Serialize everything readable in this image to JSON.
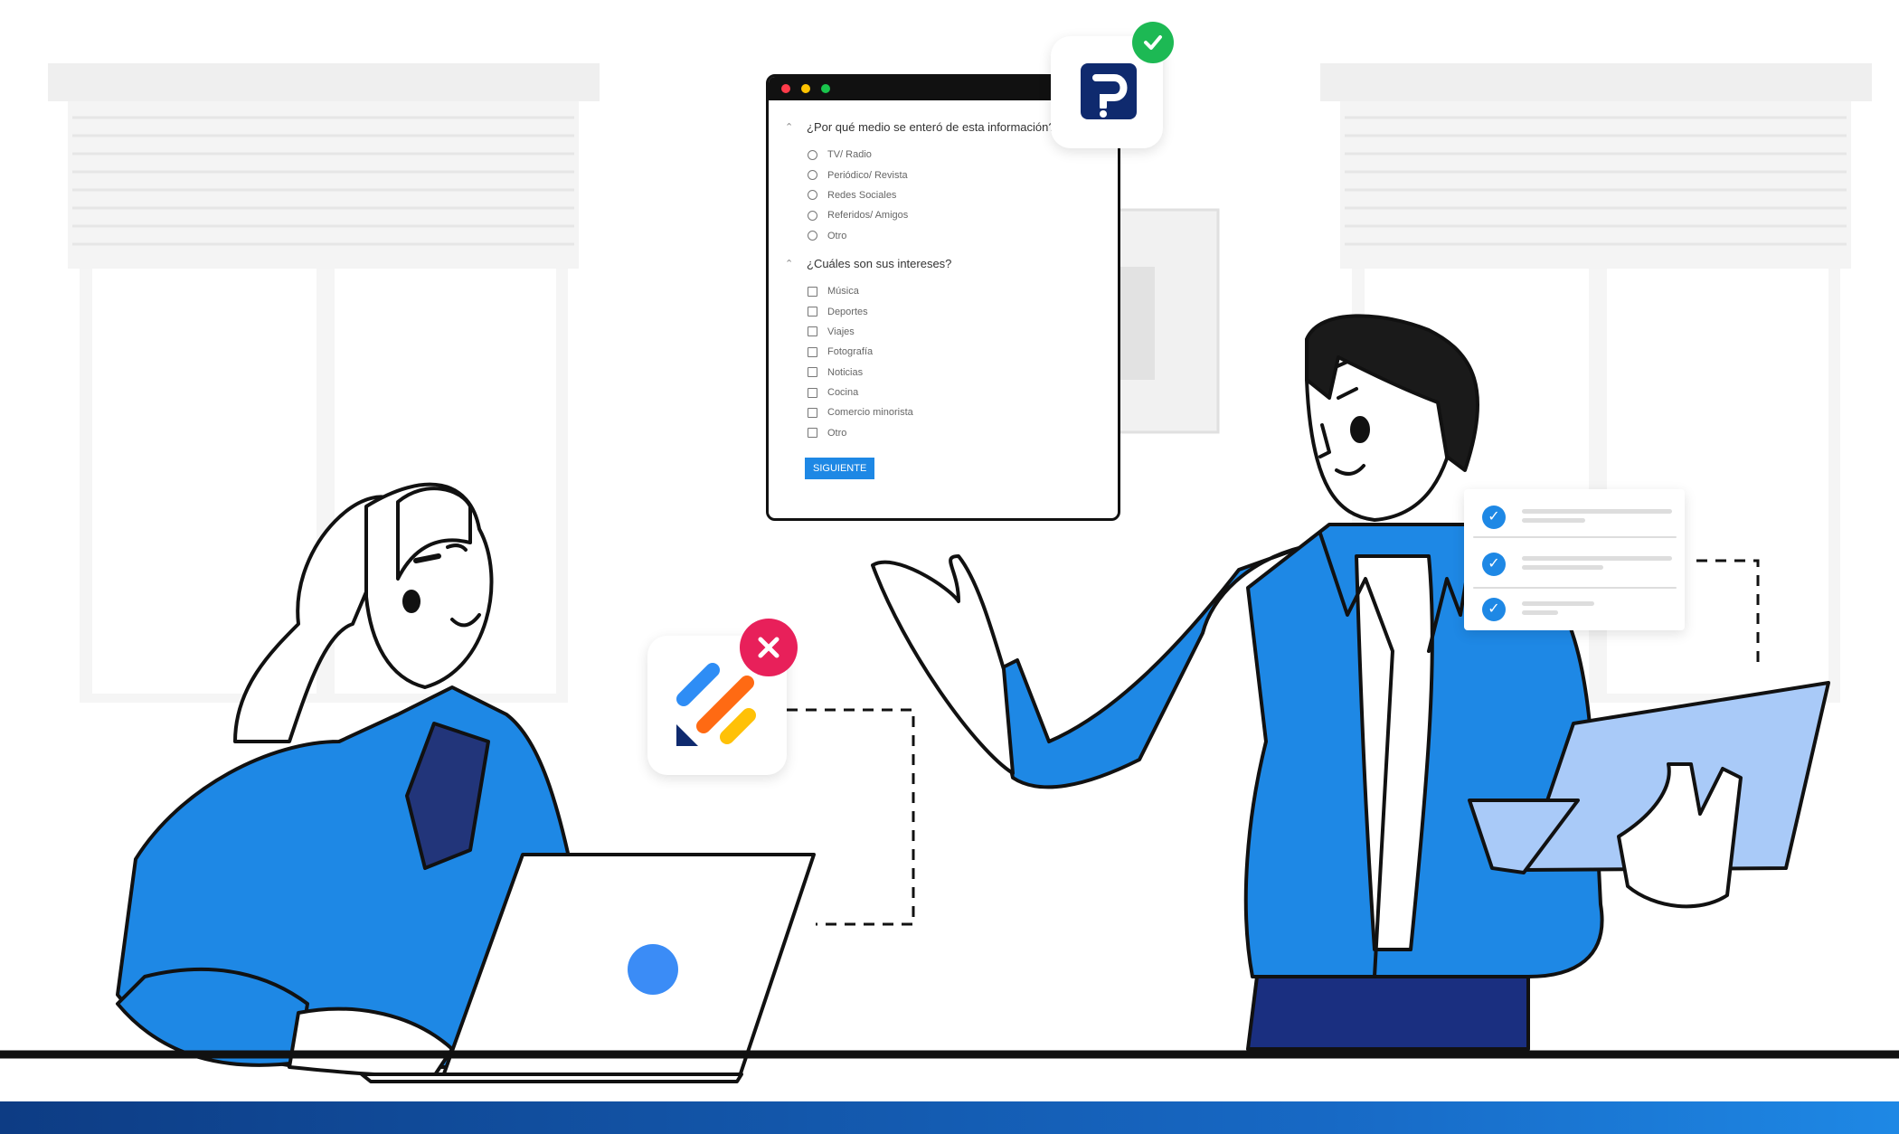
{
  "form": {
    "question1": "¿Por qué medio se enteró de esta información?",
    "options1": [
      "TV/ Radio",
      "Periódico/ Revista",
      "Redes Sociales",
      "Referidos/ Amigos",
      "Otro"
    ],
    "question2": "¿Cuáles son sus intereses?",
    "options2": [
      "Música",
      "Deportes",
      "Viajes",
      "Fotografía",
      "Noticias",
      "Cocina",
      "Comercio minorista",
      "Otro"
    ],
    "next_button": "SIGUIENTE"
  },
  "icons": {
    "approved_app": "p-question-logo",
    "approved_badge": "check-icon",
    "rejected_app": "colorful-stripes-logo",
    "rejected_badge": "close-icon",
    "checklist_item": "check-icon"
  },
  "colors": {
    "primary_blue": "#1e88e5",
    "dark_blue": "#0d3c84",
    "success_green": "#1db954",
    "error_red": "#e8205a",
    "logo_navy": "#0f2a6e"
  }
}
